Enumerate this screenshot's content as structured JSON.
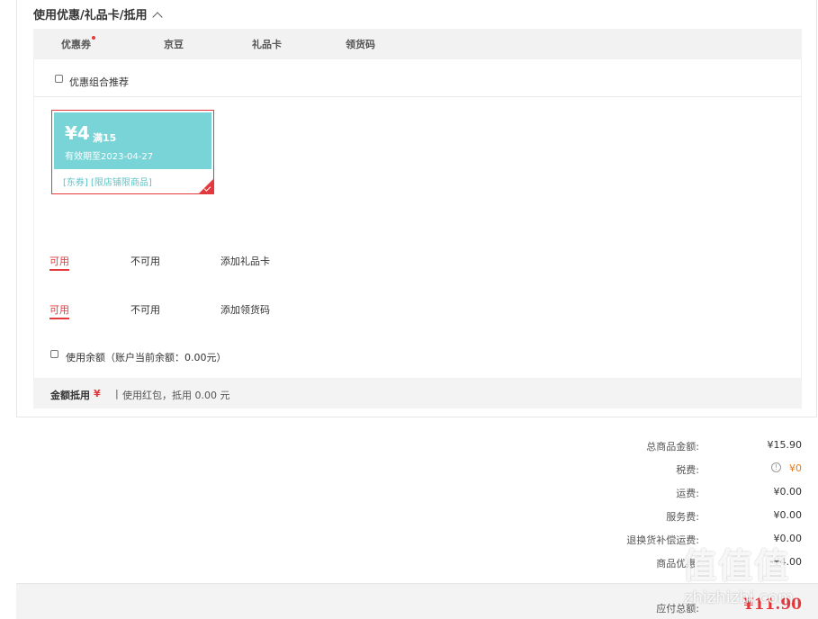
{
  "section": {
    "title": "使用优惠/礼品卡/抵用"
  },
  "tabs": [
    {
      "label": "优惠券"
    },
    {
      "label": "京豆"
    },
    {
      "label": "礼品卡"
    },
    {
      "label": "领货码"
    }
  ],
  "combo_checkbox": {
    "label": "优惠组合推荐",
    "checked": false
  },
  "coupon": {
    "amount": "¥4",
    "condition": "满15",
    "validity": "有效期至2023-04-27",
    "tags": "[东券]  [限店铺限商品]",
    "selected": true
  },
  "giftcard_tabs": {
    "available": "可用",
    "unavailable": "不可用",
    "add": "添加礼品卡"
  },
  "pickup_tabs": {
    "available": "可用",
    "unavailable": "不可用",
    "add": "添加领货码"
  },
  "balance": {
    "label": "使用余额（账户当前余额：0.00元）",
    "checked": false
  },
  "deduction": {
    "label": "金额抵用",
    "currency": "¥",
    "separator": "|",
    "detail": "使用红包，抵用 0.00 元"
  },
  "summary": [
    {
      "label": "总商品金额:",
      "value": "¥15.90"
    },
    {
      "label": "税费:",
      "value": "¥0",
      "info": "!"
    },
    {
      "label": "运费:",
      "value": "¥0.00"
    },
    {
      "label": "服务费:",
      "value": "¥0.00"
    },
    {
      "label": "退换货补偿运费:",
      "value": "¥0.00"
    },
    {
      "label": "商品优惠:",
      "value": "-¥4.00"
    }
  ],
  "total": {
    "label": "应付总额:",
    "value": "¥11.90"
  },
  "watermark": {
    "logo": "值值值",
    "site": "zhizhizhi.com"
  },
  "colors": {
    "accent": "#e4393c",
    "coupon": "#79d4d7",
    "tax_value": "#e77b1a"
  }
}
